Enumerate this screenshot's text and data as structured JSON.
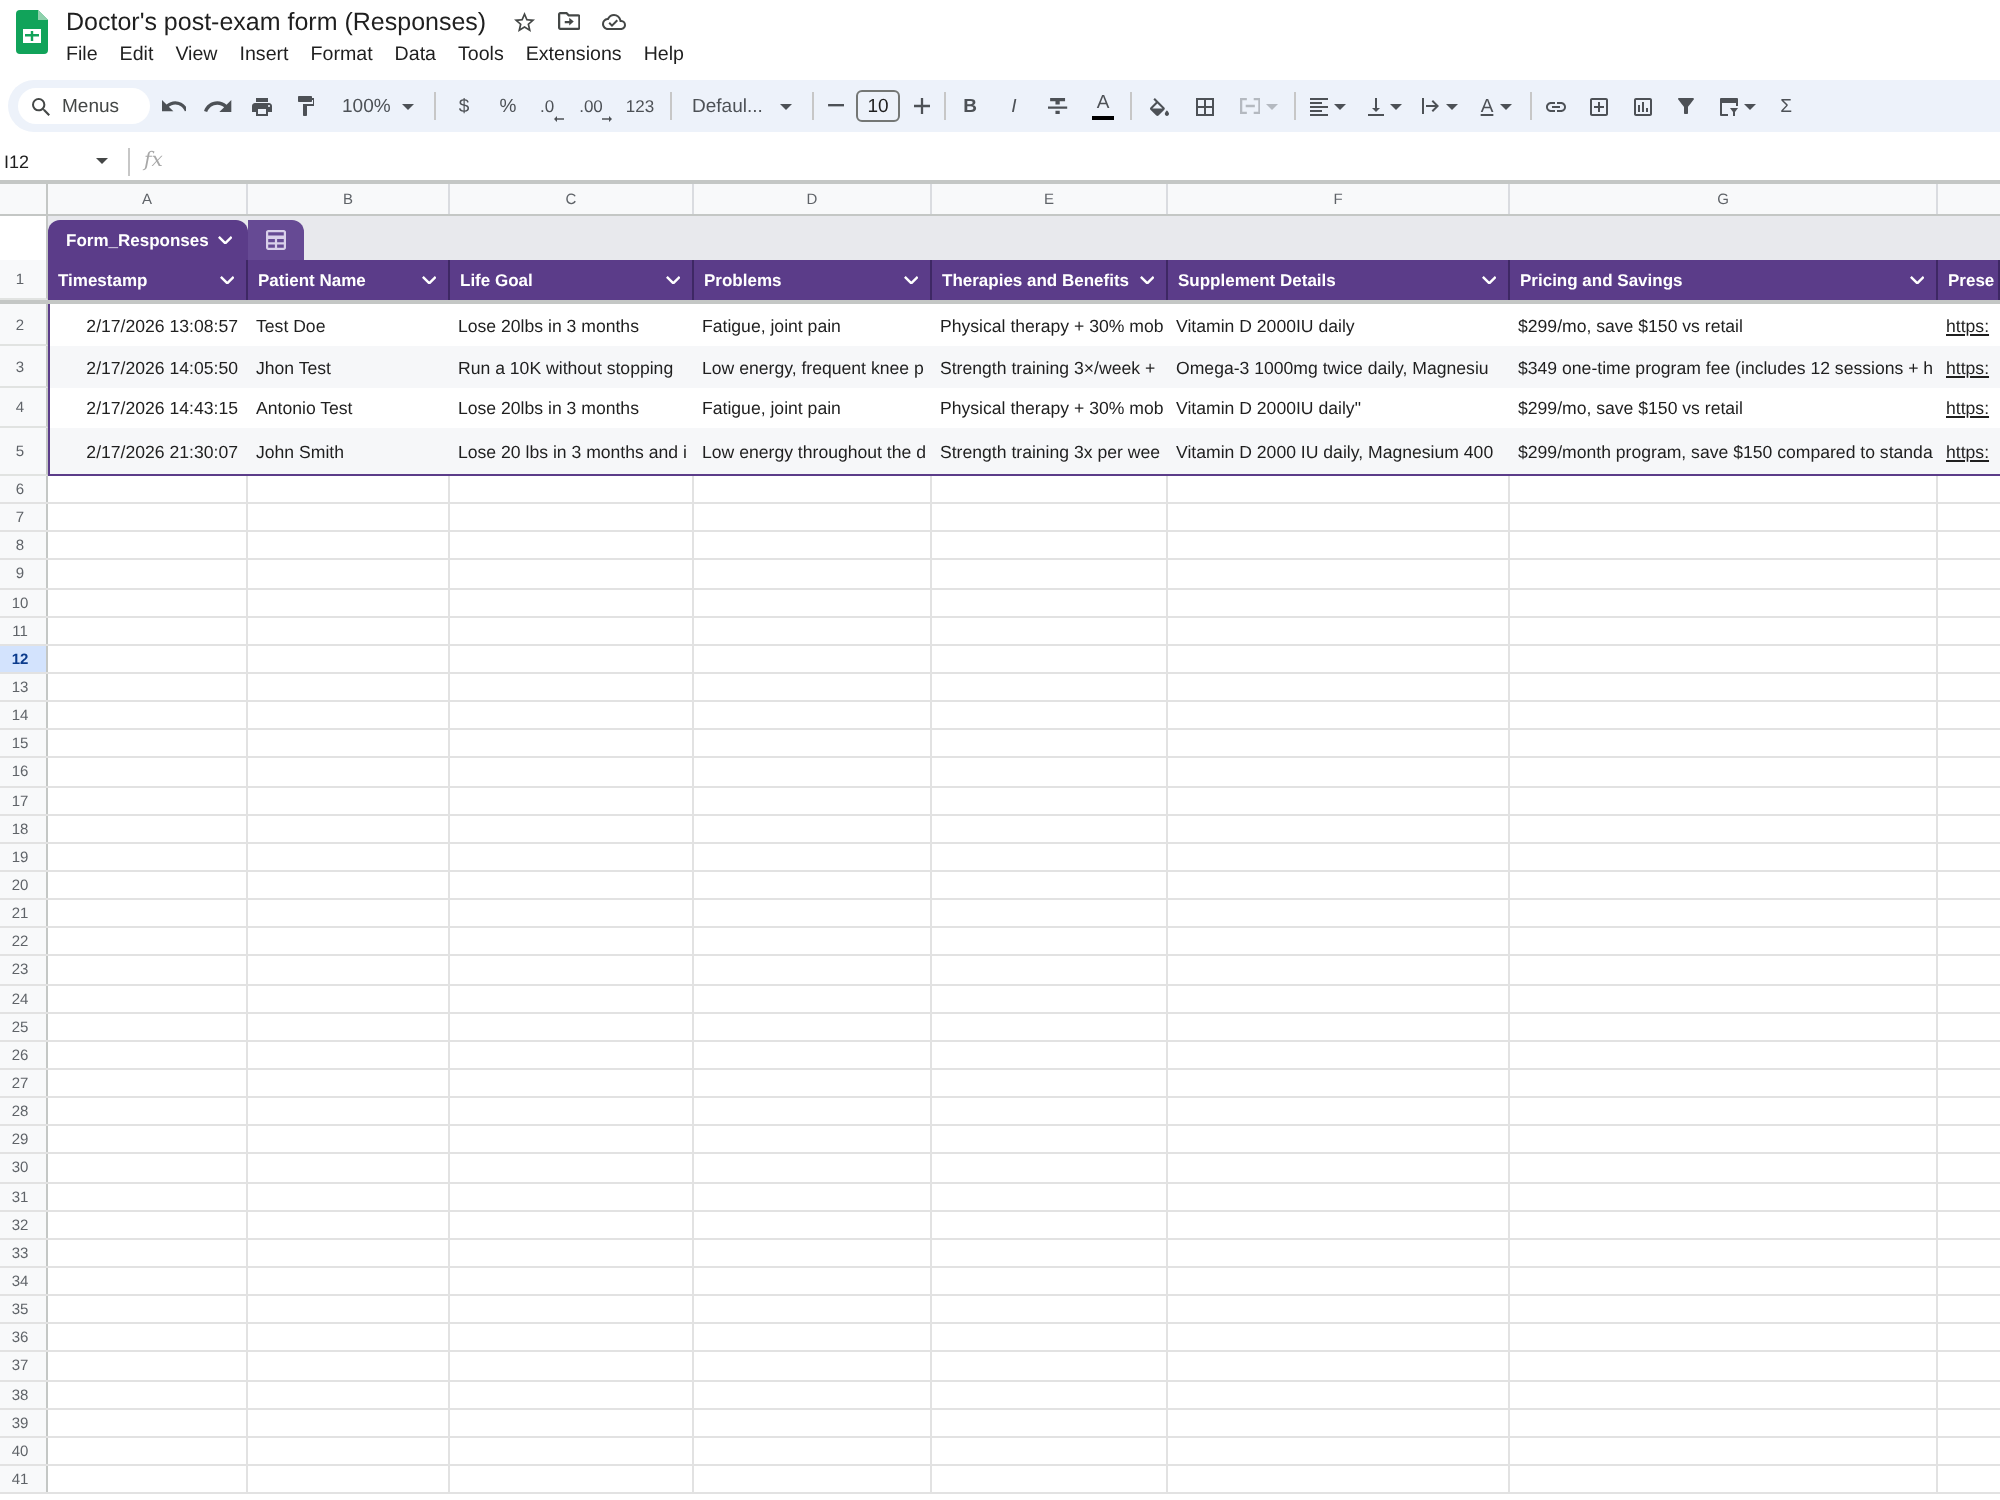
{
  "document": {
    "title": "Doctor's post-exam form (Responses)"
  },
  "menu_bar": [
    "File",
    "Edit",
    "View",
    "Insert",
    "Format",
    "Data",
    "Tools",
    "Extensions",
    "Help"
  ],
  "toolbar": {
    "search": {
      "placeholder": "Menus"
    },
    "zoom": "100%",
    "number_formats": [
      "$",
      "%",
      ".0",
      ".00",
      "123"
    ],
    "font": "Defaul...",
    "font_size": "10",
    "text_styles": [
      "B",
      "I"
    ],
    "text_color": "A",
    "merge": {
      "disabled": true
    },
    "text_rotation": "A",
    "functions": "Σ"
  },
  "formula_bar": {
    "cell_reference": "I12",
    "function_label": "fx"
  },
  "grid": {
    "column_headers": [
      "A",
      "B",
      "C",
      "D",
      "E",
      "F",
      "G"
    ],
    "row_headers": [
      {
        "label": "1",
        "selected": false
      },
      {
        "label": "2",
        "selected": false
      },
      {
        "label": "3",
        "selected": false
      },
      {
        "label": "4",
        "selected": false
      },
      {
        "label": "5",
        "selected": false
      },
      {
        "label": "6",
        "selected": false
      },
      {
        "label": "7",
        "selected": false
      },
      {
        "label": "8",
        "selected": false
      },
      {
        "label": "9",
        "selected": false
      },
      {
        "label": "10",
        "selected": false
      },
      {
        "label": "11",
        "selected": false
      },
      {
        "label": "12",
        "selected": true
      },
      {
        "label": "13",
        "selected": false
      },
      {
        "label": "14",
        "selected": false
      },
      {
        "label": "15",
        "selected": false
      },
      {
        "label": "16",
        "selected": false
      },
      {
        "label": "17",
        "selected": false
      },
      {
        "label": "18",
        "selected": false
      },
      {
        "label": "19",
        "selected": false
      },
      {
        "label": "20",
        "selected": false
      },
      {
        "label": "21",
        "selected": false
      },
      {
        "label": "22",
        "selected": false
      },
      {
        "label": "23",
        "selected": false
      },
      {
        "label": "24",
        "selected": false
      },
      {
        "label": "25",
        "selected": false
      },
      {
        "label": "26",
        "selected": false
      },
      {
        "label": "27",
        "selected": false
      },
      {
        "label": "28",
        "selected": false
      },
      {
        "label": "29",
        "selected": false
      },
      {
        "label": "30",
        "selected": false
      },
      {
        "label": "31",
        "selected": false
      },
      {
        "label": "32",
        "selected": false
      },
      {
        "label": "33",
        "selected": false
      },
      {
        "label": "34",
        "selected": false
      },
      {
        "label": "35",
        "selected": false
      },
      {
        "label": "36",
        "selected": false
      },
      {
        "label": "37",
        "selected": false
      },
      {
        "label": "38",
        "selected": false
      },
      {
        "label": "39",
        "selected": false
      },
      {
        "label": "40",
        "selected": false
      },
      {
        "label": "41",
        "selected": false
      }
    ]
  },
  "table": {
    "name": "Form_Responses",
    "columns": [
      {
        "label": "Timestamp",
        "kind": "timestamp",
        "dropdown": true
      },
      {
        "label": "Patient Name",
        "kind": "text",
        "dropdown": true
      },
      {
        "label": "Life Goal",
        "kind": "text",
        "dropdown": true
      },
      {
        "label": "Problems",
        "kind": "text",
        "dropdown": true
      },
      {
        "label": "Therapies and Benefits",
        "kind": "text",
        "dropdown": true
      },
      {
        "label": "Supplement Details",
        "kind": "text",
        "dropdown": true
      },
      {
        "label": "Pricing and Savings",
        "kind": "text",
        "dropdown": true
      },
      {
        "label": "Prese",
        "kind": "link",
        "dropdown": false
      }
    ],
    "rows": [
      [
        "2/17/2026 13:08:57",
        "Test Doe",
        "Lose 20lbs in 3 months",
        "Fatigue, joint pain",
        "Physical therapy + 30% mob",
        "Vitamin D 2000IU daily",
        "$299/mo, save $150 vs retail",
        "https:"
      ],
      [
        "2/17/2026 14:05:50",
        "Jhon Test",
        "Run a 10K without stopping",
        "Low energy, frequent knee p",
        "Strength training 3×/week +",
        "Omega-3 1000mg twice daily, Magnesiu",
        "$349 one-time program fee (includes 12 sessions + h",
        "https:"
      ],
      [
        "2/17/2026 14:43:15",
        "Antonio Test",
        "Lose 20lbs in 3 months",
        "Fatigue, joint pain",
        "Physical therapy + 30% mob",
        "Vitamin D 2000IU daily\"",
        "$299/mo, save $150 vs retail",
        "https:"
      ],
      [
        "2/17/2026 21:30:07",
        "John Smith",
        "Lose 20 lbs in 3 months and i",
        "Low energy throughout the d",
        "Strength training 3x per wee",
        "Vitamin D 2000 IU daily, Magnesium 400",
        "$299/month program, save $150 compared to standa",
        "https:"
      ]
    ]
  }
}
